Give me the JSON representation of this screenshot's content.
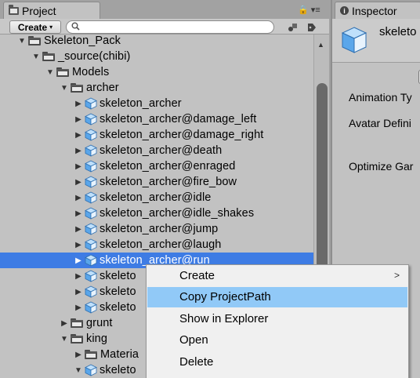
{
  "project_panel": {
    "tab_label": "Project",
    "tab_tools": "🔒 ▾≡",
    "toolbar": {
      "create_label": "Create",
      "create_caret": "▾",
      "search_value": "",
      "search_placeholder": ""
    }
  },
  "tree": [
    {
      "label": "Skeleton_Pack",
      "depth": 0,
      "type": "folder",
      "expanded": true
    },
    {
      "label": "_source(chibi)",
      "depth": 1,
      "type": "folder",
      "expanded": true
    },
    {
      "label": "Models",
      "depth": 2,
      "type": "folder",
      "expanded": true
    },
    {
      "label": "archer",
      "depth": 3,
      "type": "folder",
      "expanded": true
    },
    {
      "label": "skeleton_archer",
      "depth": 4,
      "type": "model",
      "expanded": false
    },
    {
      "label": "skeleton_archer@damage_left",
      "depth": 4,
      "type": "model",
      "expanded": false
    },
    {
      "label": "skeleton_archer@damage_right",
      "depth": 4,
      "type": "model",
      "expanded": false
    },
    {
      "label": "skeleton_archer@death",
      "depth": 4,
      "type": "model",
      "expanded": false
    },
    {
      "label": "skeleton_archer@enraged",
      "depth": 4,
      "type": "model",
      "expanded": false
    },
    {
      "label": "skeleton_archer@fire_bow",
      "depth": 4,
      "type": "model",
      "expanded": false
    },
    {
      "label": "skeleton_archer@idle",
      "depth": 4,
      "type": "model",
      "expanded": false
    },
    {
      "label": "skeleton_archer@idle_shakes",
      "depth": 4,
      "type": "model",
      "expanded": false
    },
    {
      "label": "skeleton_archer@jump",
      "depth": 4,
      "type": "model",
      "expanded": false
    },
    {
      "label": "skeleton_archer@laugh",
      "depth": 4,
      "type": "model",
      "expanded": false
    },
    {
      "label": "skeleton_archer@run",
      "depth": 4,
      "type": "model",
      "expanded": false,
      "selected": true
    },
    {
      "label": "skeleto",
      "depth": 4,
      "type": "model",
      "expanded": false
    },
    {
      "label": "skeleto",
      "depth": 4,
      "type": "model",
      "expanded": false
    },
    {
      "label": "skeleto",
      "depth": 4,
      "type": "model",
      "expanded": false
    },
    {
      "label": "grunt",
      "depth": 3,
      "type": "folder",
      "expanded": false
    },
    {
      "label": "king",
      "depth": 3,
      "type": "folder",
      "expanded": true
    },
    {
      "label": "Materia",
      "depth": 4,
      "type": "folder",
      "expanded": false
    },
    {
      "label": "skeleto",
      "depth": 4,
      "type": "model",
      "expanded": true
    }
  ],
  "inspector": {
    "tab_label": "Inspector",
    "asset_name": "skeleto",
    "properties": [
      "Animation Ty",
      "Avatar Defini",
      "Optimize Gar"
    ]
  },
  "context_menu": {
    "items": [
      {
        "label": "Create",
        "has_submenu": true,
        "highlighted": false
      },
      {
        "label": "Copy ProjectPath",
        "has_submenu": false,
        "highlighted": true
      },
      {
        "label": "Show in Explorer",
        "has_submenu": false,
        "highlighted": false
      },
      {
        "label": "Open",
        "has_submenu": false,
        "highlighted": false
      },
      {
        "label": "Delete",
        "has_submenu": false,
        "highlighted": false
      }
    ],
    "submenu_arrow": ">"
  },
  "colors": {
    "selection": "#3e7ce4",
    "menu_highlight": "#91c9f7",
    "panel_bg": "#c2c2c2",
    "model_icon": "#5aa6ea"
  }
}
